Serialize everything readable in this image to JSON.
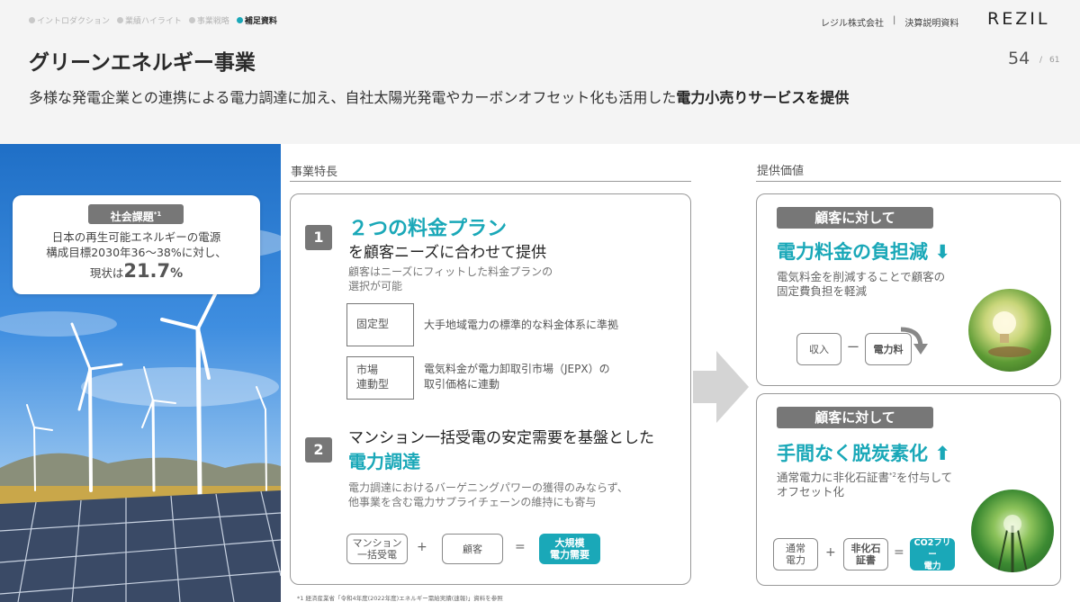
{
  "nav": {
    "items": [
      {
        "label": "イントロダクション",
        "active": false
      },
      {
        "label": "業績ハイライト",
        "active": false
      },
      {
        "label": "事業戦略",
        "active": false
      },
      {
        "label": "補足資料",
        "active": true
      }
    ]
  },
  "header": {
    "company": "レジル株式会社",
    "separator": "|",
    "doc_type": "決算説明資料",
    "logo": "REZIL",
    "page_number": "54",
    "page_slash": "/",
    "page_total": "61"
  },
  "title": "グリーンエネルギー事業",
  "subtitle": {
    "plain": "多様な発電企業との連携による電力調達に加え、自社太陽光発電やカーボンオフセット化も活用した",
    "bold": "電力小売りサービスを提供"
  },
  "issue": {
    "tag": "社会課題",
    "tag_note": "*1",
    "line1": "日本の再生可能エネルギーの電源",
    "line2": "構成目標2030年36～38%に対し、",
    "now_prefix": "現状は",
    "value": "21.7",
    "unit": "%"
  },
  "features": {
    "section_label": "事業特長",
    "item1": {
      "num": "1",
      "headline": "２つの料金プラン",
      "subhead": "を顧客ニーズに合わせて提供",
      "desc_line1": "顧客はニーズにフィットした料金プランの",
      "desc_line2": "選択が可能",
      "plans": [
        {
          "name": "固定型",
          "desc": "大手地域電力の標準的な料金体系に準拠"
        },
        {
          "name_line1": "市場",
          "name_line2": "連動型",
          "desc_line1": "電気料金が電力卸取引市場（JEPX）の",
          "desc_line2": "取引価格に連動"
        }
      ]
    },
    "item2": {
      "num": "2",
      "subhead": "マンション一括受電の安定需要を基盤とした",
      "headline": "電力調達",
      "desc_line1": "電力調達におけるバーゲニングパワーの獲得のみならず、",
      "desc_line2": "他事業を含む電力サプライチェーンの維持にも寄与",
      "eq": {
        "a_line1": "マンション",
        "a_line2": "一括受電",
        "plus": "+",
        "b": "顧客",
        "equals": "=",
        "c_line1": "大規模",
        "c_line2": "電力需要"
      }
    }
  },
  "values": {
    "section_label": "提供価値",
    "box1": {
      "tag": "顧客に対して",
      "headline": "電力料金の負担減",
      "arrow": "⬇",
      "desc_line1": "電気料金を削減することで顧客の",
      "desc_line2": "固定費負担を軽減",
      "eq_a": "収入",
      "eq_minus": "ー",
      "eq_b": "電力料"
    },
    "box2": {
      "tag": "顧客に対して",
      "headline": "手間なく脱炭素化",
      "arrow": "⬆",
      "desc_pre": "通常電力に非化石証書",
      "desc_note": "*2",
      "desc_post": "を付与して",
      "desc_line2": "オフセット化",
      "eq_a_line1": "通常",
      "eq_a_line2": "電力",
      "eq_plus": "+",
      "eq_b_line1": "非化石",
      "eq_b_line2": "証書",
      "eq_equals": "=",
      "eq_c_line1": "CO2フリー",
      "eq_c_line2": "電力"
    }
  },
  "footnote": "*1 経済産業省「令和4年度(2022年度)エネルギー需給実績(速報)」資料を参照",
  "colors": {
    "accent": "#1aa8b8",
    "tag_gray": "#777777",
    "bg": "#f4f4f4"
  }
}
